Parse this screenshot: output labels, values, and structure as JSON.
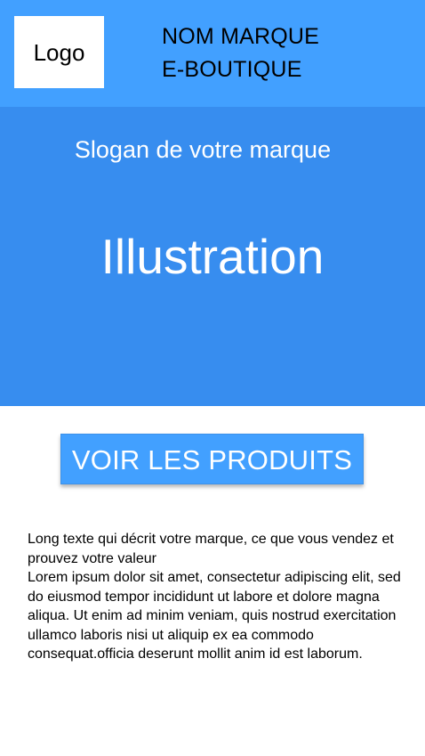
{
  "header": {
    "logo_label": "Logo",
    "brand_name_line1": "NOM MARQUE",
    "brand_name_line2": "E-BOUTIQUE"
  },
  "hero": {
    "slogan": "Slogan de votre marque",
    "illustration_label": "Illustration"
  },
  "cta": {
    "label": "VOIR LES PRODUITS"
  },
  "description": {
    "intro": "Long texte qui décrit votre marque, ce que vous vendez et prouvez votre valeur",
    "paragraph1": "Lorem ipsum dolor sit amet, consectetur adipiscing elit, sed do eiusmod tempor incididunt ut labore et dolore magna",
    "paragraph2": "aliqua. Ut enim ad minim veniam, quis nostrud exercitation ullamco laboris nisi ut aliquip ex ea commodo consequat.officia deserunt mollit anim id est laborum."
  },
  "colors": {
    "header_background": "#42a0ff",
    "hero_background": "#378def",
    "button_background": "#42a0ff",
    "page_background": "#ffffff",
    "text_dark": "#000000",
    "text_light": "#ffffff"
  }
}
